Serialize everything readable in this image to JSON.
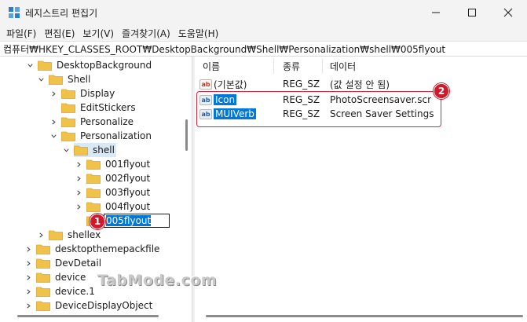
{
  "window": {
    "title": "레지스트리 편집기",
    "icon": "registry-editor-icon"
  },
  "menu": [
    "파일(F)",
    "편집(E)",
    "보기(V)",
    "즐겨찾기(A)",
    "도움말(H)"
  ],
  "address": "컴퓨터₩HKEY_CLASSES_ROOT₩DesktopBackground₩Shell₩Personalization₩shell₩005flyout",
  "tree": {
    "items": [
      {
        "label": "DesktopBackground",
        "expanded": true
      },
      {
        "label": "Shell",
        "expanded": true
      },
      {
        "label": "Display",
        "expanded": false
      },
      {
        "label": "EditStickers",
        "expanded": false
      },
      {
        "label": "Personalize",
        "expanded": false
      },
      {
        "label": "Personalization",
        "expanded": true
      },
      {
        "label": "shell",
        "expanded": true
      },
      {
        "label": "001flyout",
        "expanded": false
      },
      {
        "label": "002flyout",
        "expanded": false
      },
      {
        "label": "003flyout",
        "expanded": false
      },
      {
        "label": "004flyout",
        "expanded": false
      },
      {
        "label": "005flyout",
        "editing": true
      },
      {
        "label": "shellex",
        "expanded": false
      },
      {
        "label": "desktopthemepackfile",
        "expanded": false
      },
      {
        "label": "DevDetail",
        "expanded": false
      },
      {
        "label": "device",
        "expanded": false
      },
      {
        "label": "device.1",
        "expanded": false
      },
      {
        "label": "DeviceDisplayObject",
        "expanded": false
      }
    ]
  },
  "list": {
    "columns": [
      "이름",
      "종류",
      "데이터"
    ],
    "rows": [
      {
        "name": "(기본값)",
        "type": "REG_SZ",
        "data": "(값 설정 안 됨)",
        "icon": "ab-string-icon"
      },
      {
        "name": "Icon",
        "type": "REG_SZ",
        "data": "PhotoScreensaver.scr",
        "icon": "ab-string-icon",
        "selected": true
      },
      {
        "name": "MUIVerb",
        "type": "REG_SZ",
        "data": "Screen Saver Settings",
        "icon": "ab-string-icon",
        "selected": true
      }
    ]
  },
  "annotations": {
    "badge1": "1",
    "badge2": "2",
    "highlight_color": "#d9283a"
  },
  "watermark": "TabMode.com",
  "colors": {
    "selection": "#0078d7",
    "folder": "#f0c24a"
  }
}
